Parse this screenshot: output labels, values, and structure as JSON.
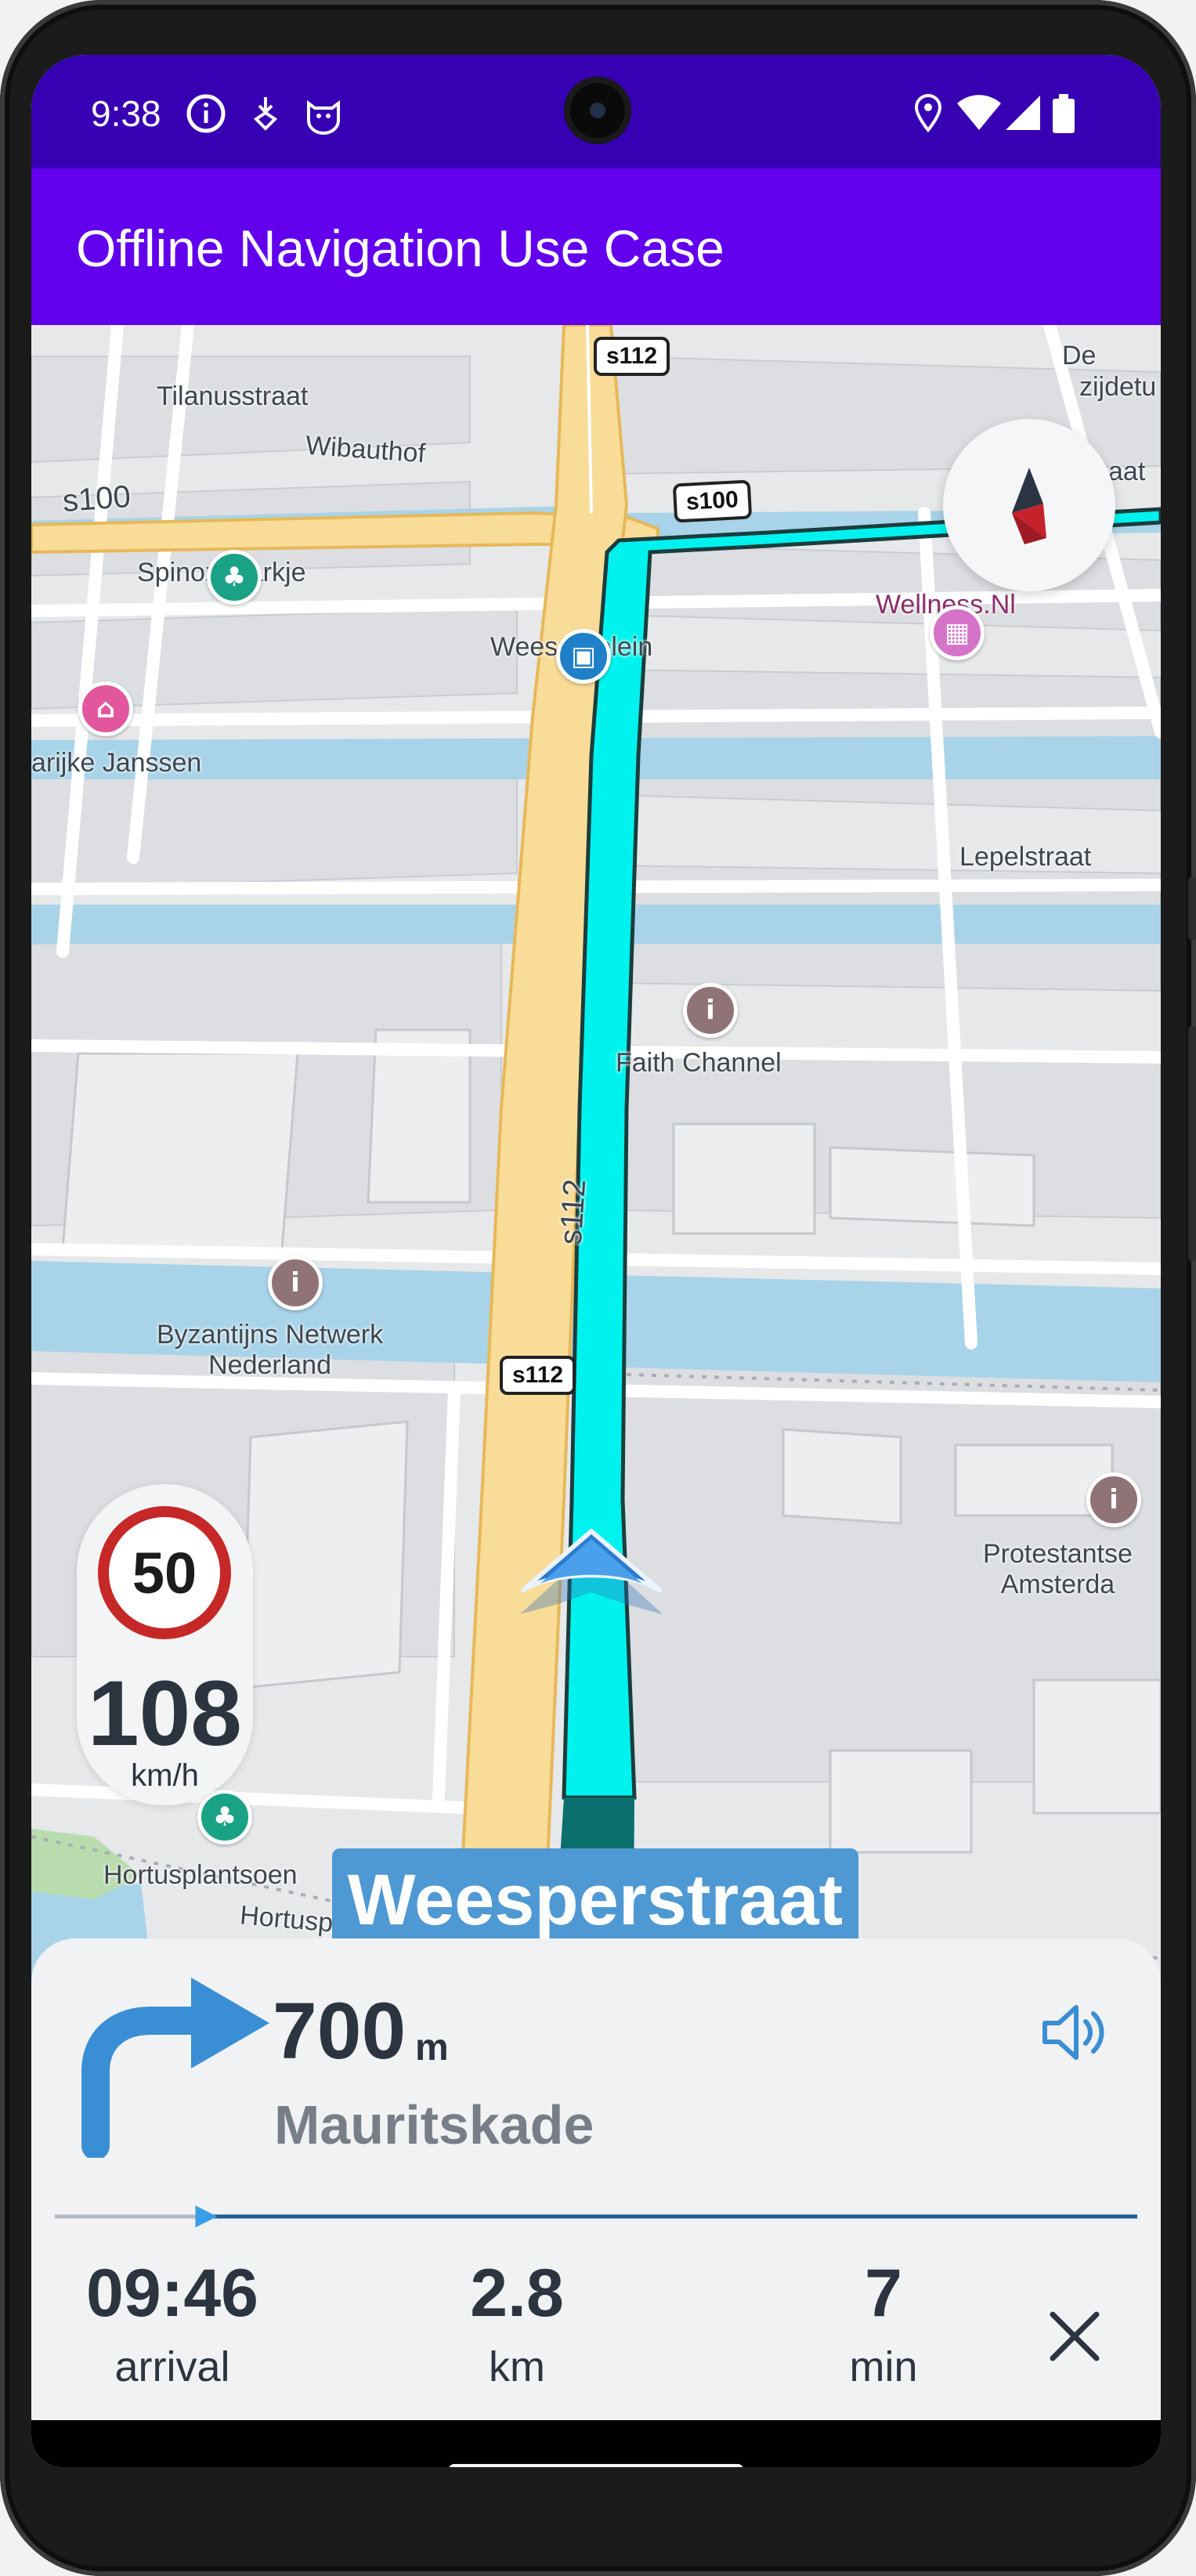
{
  "status_bar": {
    "time": "9:38",
    "icons": [
      "info-icon",
      "download-icon",
      "cat-icon",
      "location-icon",
      "wifi-icon",
      "signal-icon",
      "battery-icon"
    ]
  },
  "app_bar": {
    "title": "Offline Navigation Use Case"
  },
  "map": {
    "route_shields": [
      "s112",
      "s100",
      "s112",
      "s112"
    ],
    "labels": {
      "tilanusstraat": "Tilanusstraat",
      "wibauthof": "Wibauthof",
      "s100": "s100",
      "spinozaparkje": "Spinozaparkje",
      "weesperplein": "Weesperplein",
      "janssen": "arijke Janssen",
      "wellness": "Wellness.Nl",
      "lepelstraat": "Lepelstraat",
      "faith_channel": "Faith Channel",
      "s112_road": "s112",
      "byzantijns_line1": "Byzantijns Netwerk",
      "byzantijns_line2": "Nederland",
      "protestantse_line1": "Protestantse",
      "protestantse_line2": "Amsterda",
      "hortusplantsoen": "Hortusplantsoen",
      "hortusplantsoen_road": "Hortusplantsoen",
      "de_top": "De",
      "zijdetu": "zijdetu",
      "aat": "aat"
    },
    "current_street": "Weesperstraat"
  },
  "speed": {
    "limit": "50",
    "current": "108",
    "unit": "km/h"
  },
  "instruction": {
    "distance_value": "700",
    "distance_unit": "m",
    "next_street": "Mauritskade",
    "maneuver_icon": "turn-right-icon"
  },
  "trip": {
    "arrival_value": "09:46",
    "arrival_label": "arrival",
    "distance_value": "2.8",
    "distance_label": "km",
    "time_value": "7",
    "time_label": "min",
    "progress": 0.14
  },
  "colors": {
    "status_bar": "#3700b3",
    "app_bar": "#6200ee",
    "route": "#00f2ee",
    "route_past": "#0b6f6e",
    "main_road": "#f8dc98",
    "water": "#a8d3e8",
    "position_arrow": "#2b7bd0",
    "speed_limit_ring": "#c62828",
    "progress_line": "#1a5c96"
  }
}
